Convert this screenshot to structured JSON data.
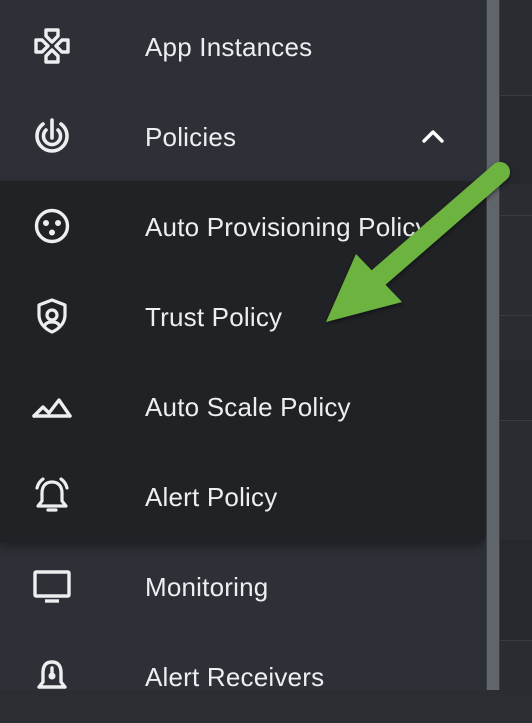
{
  "sidebar": {
    "items": [
      {
        "label": "App Instances",
        "icon": "gamepad-icon"
      },
      {
        "label": "Policies",
        "icon": "policies-icon",
        "expanded": true
      },
      {
        "label": "Monitoring",
        "icon": "monitor-icon"
      },
      {
        "label": "Alert Receivers",
        "icon": "bell-icon"
      }
    ],
    "policies_submenu": [
      {
        "label": "Auto Provisioning Policy",
        "icon": "dots-circle-icon"
      },
      {
        "label": "Trust Policy",
        "icon": "shield-icon"
      },
      {
        "label": "Auto Scale Policy",
        "icon": "mountains-icon"
      },
      {
        "label": "Alert Policy",
        "icon": "alarm-bell-icon"
      }
    ]
  },
  "colors": {
    "sidebar_bg": "#2e3037",
    "submenu_bg": "#212226",
    "text": "#eceef0",
    "annotation_arrow": "#6db33f"
  }
}
